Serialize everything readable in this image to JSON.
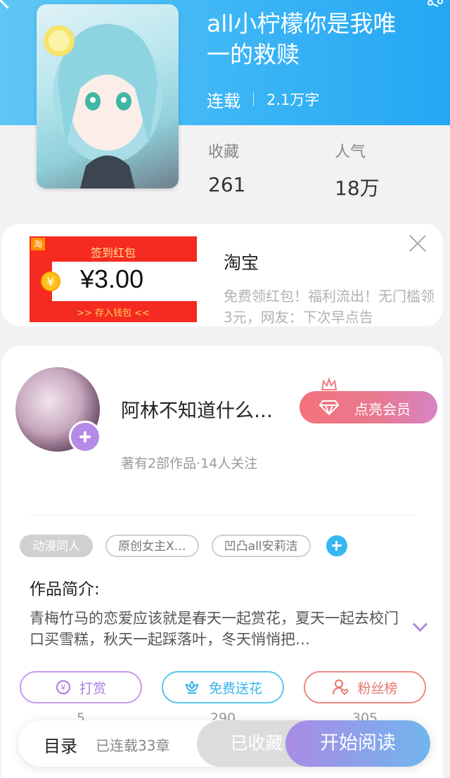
{
  "book": {
    "title": "all小柠檬你是我唯一的救赎",
    "status": "连载",
    "word_count": "2.1万字",
    "stats": {
      "favorites_label": "收藏",
      "favorites_value": "261",
      "popularity_label": "人气",
      "popularity_value": "18万"
    }
  },
  "ad": {
    "banner_logo": "淘",
    "banner_title": "签到红包",
    "banner_coin": "¥",
    "banner_amount": "¥3.00",
    "banner_footer": ">>  存入钱包  <<",
    "brand": "淘宝",
    "description": "免费领红包！福利流出！无门槛领3元，网友：下次早点告"
  },
  "author": {
    "name": "阿林不知道什么…",
    "meta": "著有2部作品·14人关注",
    "vip_button": "点亮会员"
  },
  "tags": [
    "动漫同人",
    "原创女主X…",
    "凹凸all安莉洁"
  ],
  "intro": {
    "title": "作品简介:",
    "text": "青梅竹马的恋爱应该就是春天一起赏花，夏天一起去校门口买雪糕，秋天一起踩落叶，冬天悄悄把…"
  },
  "actions": [
    {
      "label": "打赏",
      "count": "5"
    },
    {
      "label": "免费送花",
      "count": "290"
    },
    {
      "label": "粉丝榜",
      "count": "305"
    }
  ],
  "bottom": {
    "toc_label": "目录",
    "toc_status": "已连载33章",
    "collected_label": "已收藏",
    "read_label": "开始阅读"
  },
  "colors": {
    "header": "#38b3f5",
    "accent_purple": "#a67be0",
    "accent_blue": "#38b5ec",
    "accent_red": "#e8746d"
  }
}
